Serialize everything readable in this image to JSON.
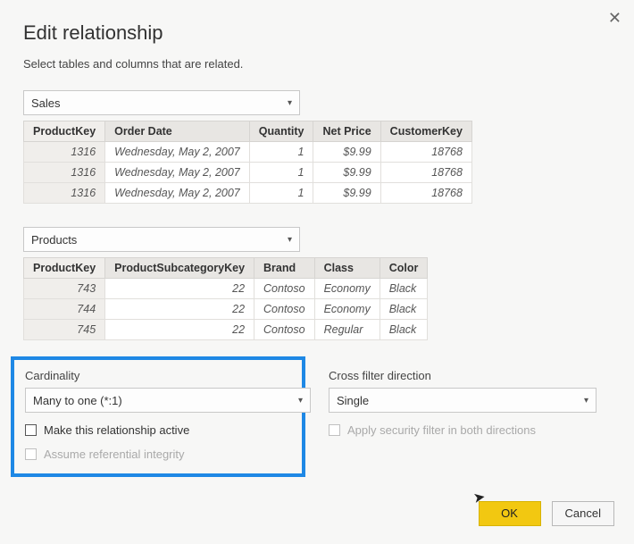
{
  "title": "Edit relationship",
  "subtitle": "Select tables and columns that are related.",
  "table1": {
    "selected": "Sales",
    "columns": [
      "ProductKey",
      "Order Date",
      "Quantity",
      "Net Price",
      "CustomerKey"
    ],
    "rows": [
      {
        "ProductKey": "1316",
        "Order Date": "Wednesday, May 2, 2007",
        "Quantity": "1",
        "Net Price": "$9.99",
        "CustomerKey": "18768"
      },
      {
        "ProductKey": "1316",
        "Order Date": "Wednesday, May 2, 2007",
        "Quantity": "1",
        "Net Price": "$9.99",
        "CustomerKey": "18768"
      },
      {
        "ProductKey": "1316",
        "Order Date": "Wednesday, May 2, 2007",
        "Quantity": "1",
        "Net Price": "$9.99",
        "CustomerKey": "18768"
      }
    ]
  },
  "table2": {
    "selected": "Products",
    "columns": [
      "ProductKey",
      "ProductSubcategoryKey",
      "Brand",
      "Class",
      "Color"
    ],
    "rows": [
      {
        "ProductKey": "743",
        "ProductSubcategoryKey": "22",
        "Brand": "Contoso",
        "Class": "Economy",
        "Color": "Black"
      },
      {
        "ProductKey": "744",
        "ProductSubcategoryKey": "22",
        "Brand": "Contoso",
        "Class": "Economy",
        "Color": "Black"
      },
      {
        "ProductKey": "745",
        "ProductSubcategoryKey": "22",
        "Brand": "Contoso",
        "Class": "Regular",
        "Color": "Black"
      }
    ]
  },
  "cardinality": {
    "label": "Cardinality",
    "value": "Many to one (*:1)",
    "make_active_label": "Make this relationship active",
    "assume_ref_label": "Assume referential integrity"
  },
  "crossfilter": {
    "label": "Cross filter direction",
    "value": "Single",
    "apply_security_label": "Apply security filter in both directions"
  },
  "buttons": {
    "ok": "OK",
    "cancel": "Cancel"
  }
}
